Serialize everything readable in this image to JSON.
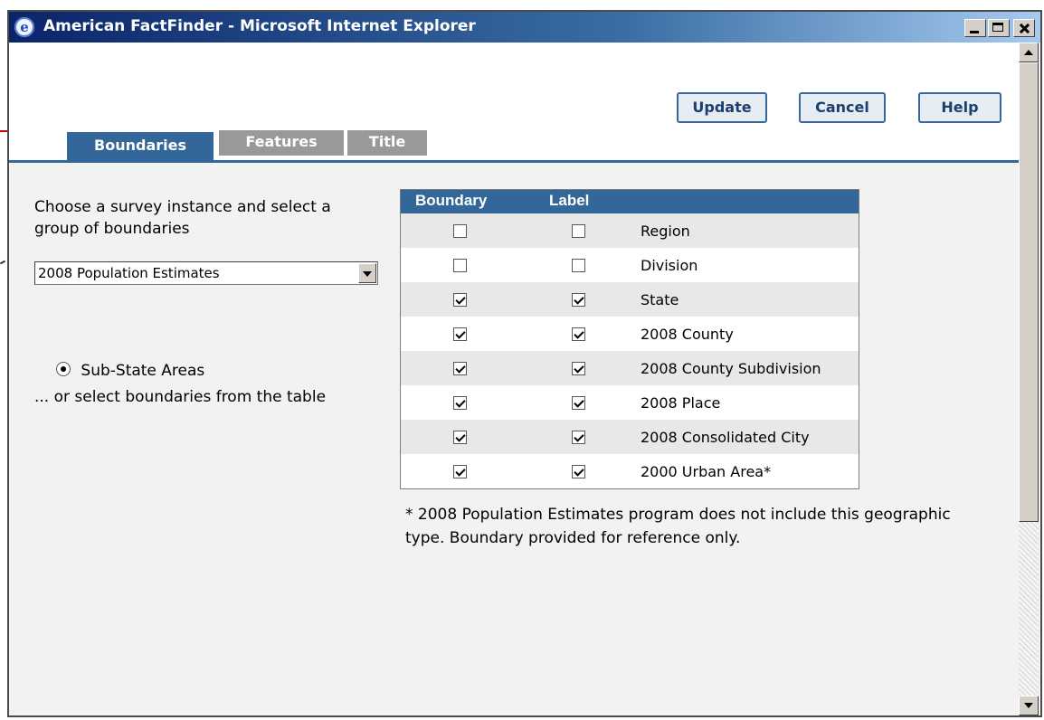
{
  "window": {
    "title": "American FactFinder - Microsoft Internet Explorer"
  },
  "toolbar": {
    "update_label": "Update",
    "cancel_label": "Cancel",
    "help_label": "Help"
  },
  "tabs": [
    {
      "label": "Boundaries",
      "active": true
    },
    {
      "label": "Features",
      "active": false
    },
    {
      "label": "Title",
      "active": false
    }
  ],
  "left": {
    "intro": "Choose a survey instance and select a group of boundaries",
    "selected_survey": "2008 Population Estimates",
    "radio_label": "Sub-State Areas",
    "or_text": "... or select boundaries from the table"
  },
  "table": {
    "headers": {
      "boundary": "Boundary",
      "label": "Label"
    },
    "rows": [
      {
        "name": "Region",
        "boundary": false,
        "label": false
      },
      {
        "name": "Division",
        "boundary": false,
        "label": false
      },
      {
        "name": "State",
        "boundary": true,
        "label": true
      },
      {
        "name": "2008 County",
        "boundary": true,
        "label": true
      },
      {
        "name": "2008 County Subdivision",
        "boundary": true,
        "label": true
      },
      {
        "name": "2008 Place",
        "boundary": true,
        "label": true
      },
      {
        "name": "2008 Consolidated City",
        "boundary": true,
        "label": true
      },
      {
        "name": "2000 Urban Area*",
        "boundary": true,
        "label": true
      }
    ]
  },
  "footnote": "* 2008 Population Estimates program does not include this geographic type. Boundary provided for reference only.",
  "colors": {
    "accent": "#336699",
    "tab_inactive": "#999999",
    "annotation_arrow": "#cc0000"
  },
  "icons": {
    "app": "ie-icon",
    "minimize": "minimize-icon",
    "maximize": "maximize-icon",
    "close": "close-icon"
  }
}
